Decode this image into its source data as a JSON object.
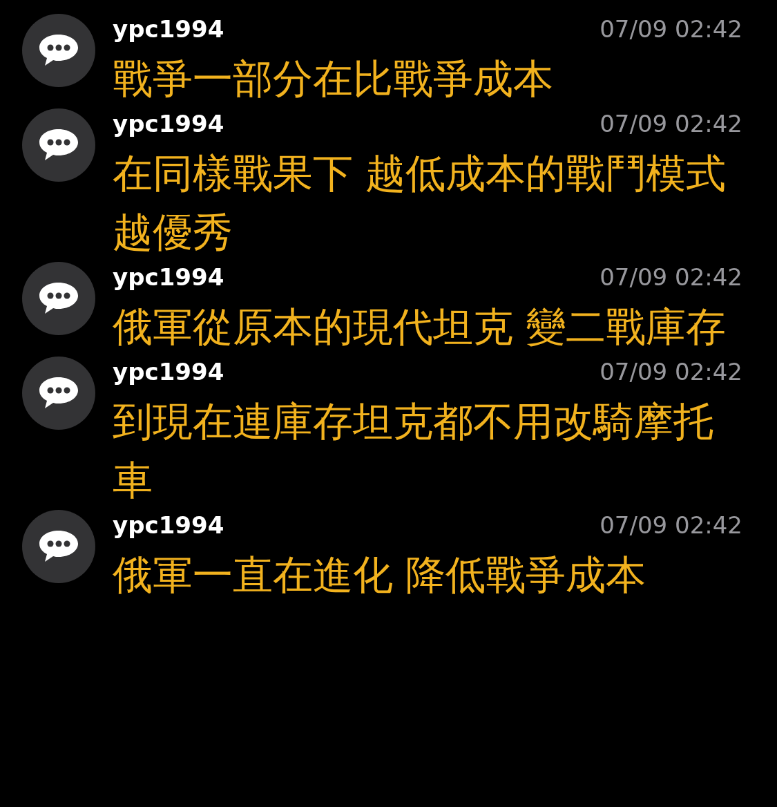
{
  "comments": [
    {
      "user": "ypc1994",
      "time": "07/09 02:42",
      "text": "戰爭一部分在比戰爭成本"
    },
    {
      "user": "ypc1994",
      "time": "07/09 02:42",
      "text": "在同樣戰果下 越低成本的戰鬥模式越優秀"
    },
    {
      "user": "ypc1994",
      "time": "07/09 02:42",
      "text": "俄軍從原本的現代坦克 變二戰庫存"
    },
    {
      "user": "ypc1994",
      "time": "07/09 02:42",
      "text": "到現在連庫存坦克都不用改騎摩托車"
    },
    {
      "user": "ypc1994",
      "time": "07/09 02:42",
      "text": "俄軍一直在進化 降低戰爭成本"
    }
  ]
}
